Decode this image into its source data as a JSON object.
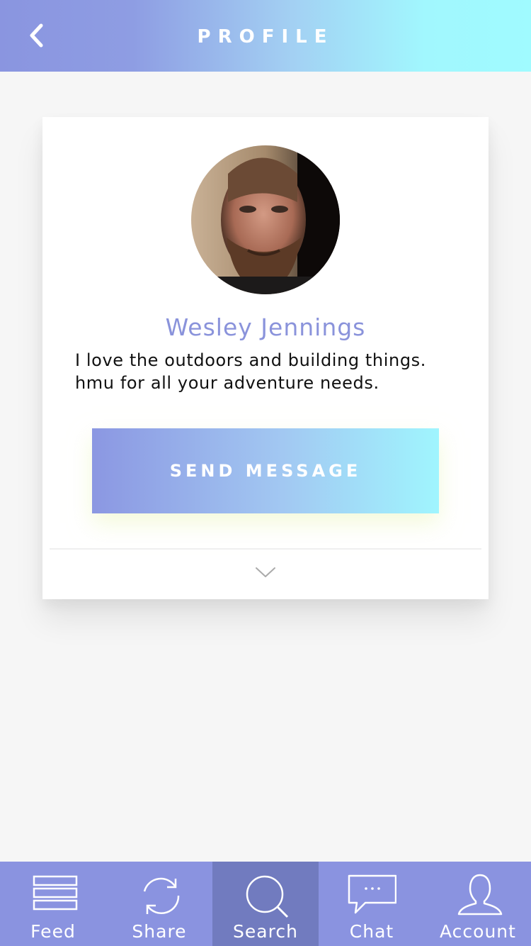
{
  "header": {
    "title": "PROFILE",
    "back_icon": "chevron-left-icon"
  },
  "profile": {
    "name": "Wesley Jennings",
    "bio_lines": [
      "I love the outdoors and building things.",
      "hmu for all your adventure needs."
    ],
    "send_button_label": "SEND MESSAGE",
    "expand_icon": "chevron-down-icon"
  },
  "tabbar": {
    "active": "Search",
    "tabs": [
      {
        "label": "Feed",
        "icon": "feed-icon"
      },
      {
        "label": "Share",
        "icon": "refresh-icon"
      },
      {
        "label": "Search",
        "icon": "search-icon"
      },
      {
        "label": "Chat",
        "icon": "chat-icon"
      },
      {
        "label": "Account",
        "icon": "account-icon"
      }
    ]
  },
  "colors": {
    "accent": "#8a93e0",
    "accent_active": "#717bbf",
    "gradient_start": "#8a95e0",
    "gradient_end": "#a0fbff",
    "name_color": "#8a93db",
    "background": "#f6f6f6"
  }
}
